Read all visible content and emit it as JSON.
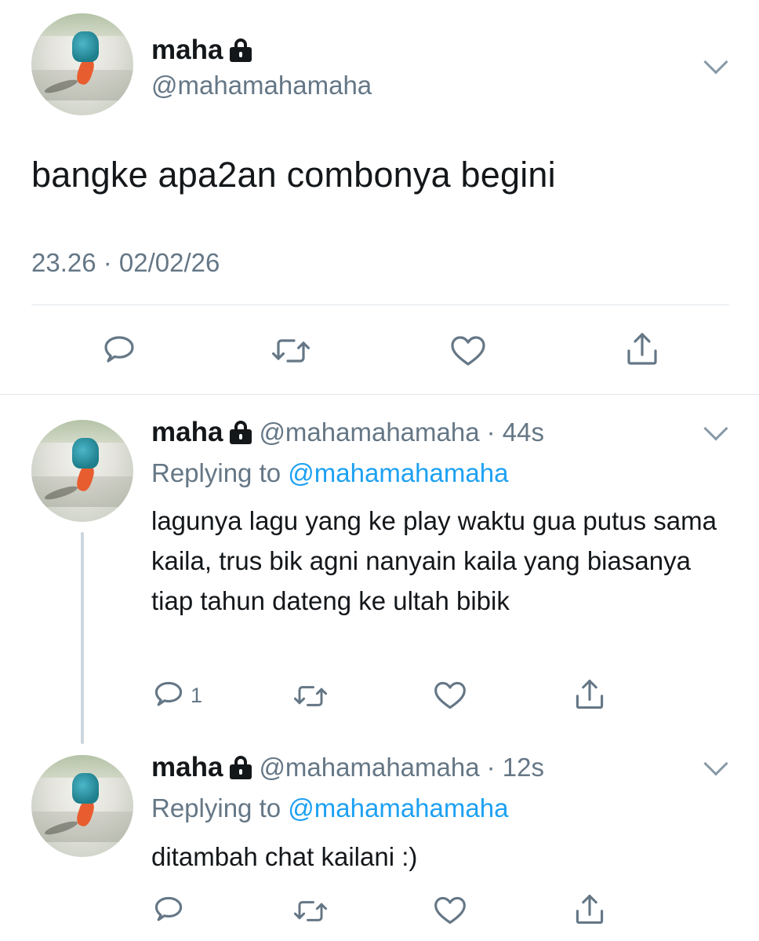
{
  "main_tweet": {
    "name": "maha",
    "handle": "@mahamahamaha",
    "text": "bangke apa2an combonya begini",
    "timestamp": "23.26 · 02/02/26",
    "actions": [
      "reply-icon",
      "retweet-icon",
      "like-icon",
      "share-icon"
    ]
  },
  "replies": [
    {
      "name": "maha",
      "handle": "@mahamahamaha",
      "time": "· 44s",
      "replying_prefix": "Replying to",
      "replying_to": "@mahamahamaha",
      "text": "lagunya lagu yang ke play waktu gua putus sama kaila, trus bik agni nanyain kaila yang biasanya tiap tahun dateng ke ultah bibik",
      "reply_count": "1"
    },
    {
      "name": "maha",
      "handle": "@mahamahamaha",
      "time": "· 12s",
      "replying_prefix": "Replying to",
      "replying_to": "@mahamahamaha",
      "text": "ditambah chat kailani :)",
      "reply_count": ""
    }
  ],
  "colors": {
    "text": "#14171a",
    "secondary": "#657786",
    "link": "#1da1f2",
    "divider": "#e1e8ed",
    "thread_line": "#ccd6dd"
  }
}
